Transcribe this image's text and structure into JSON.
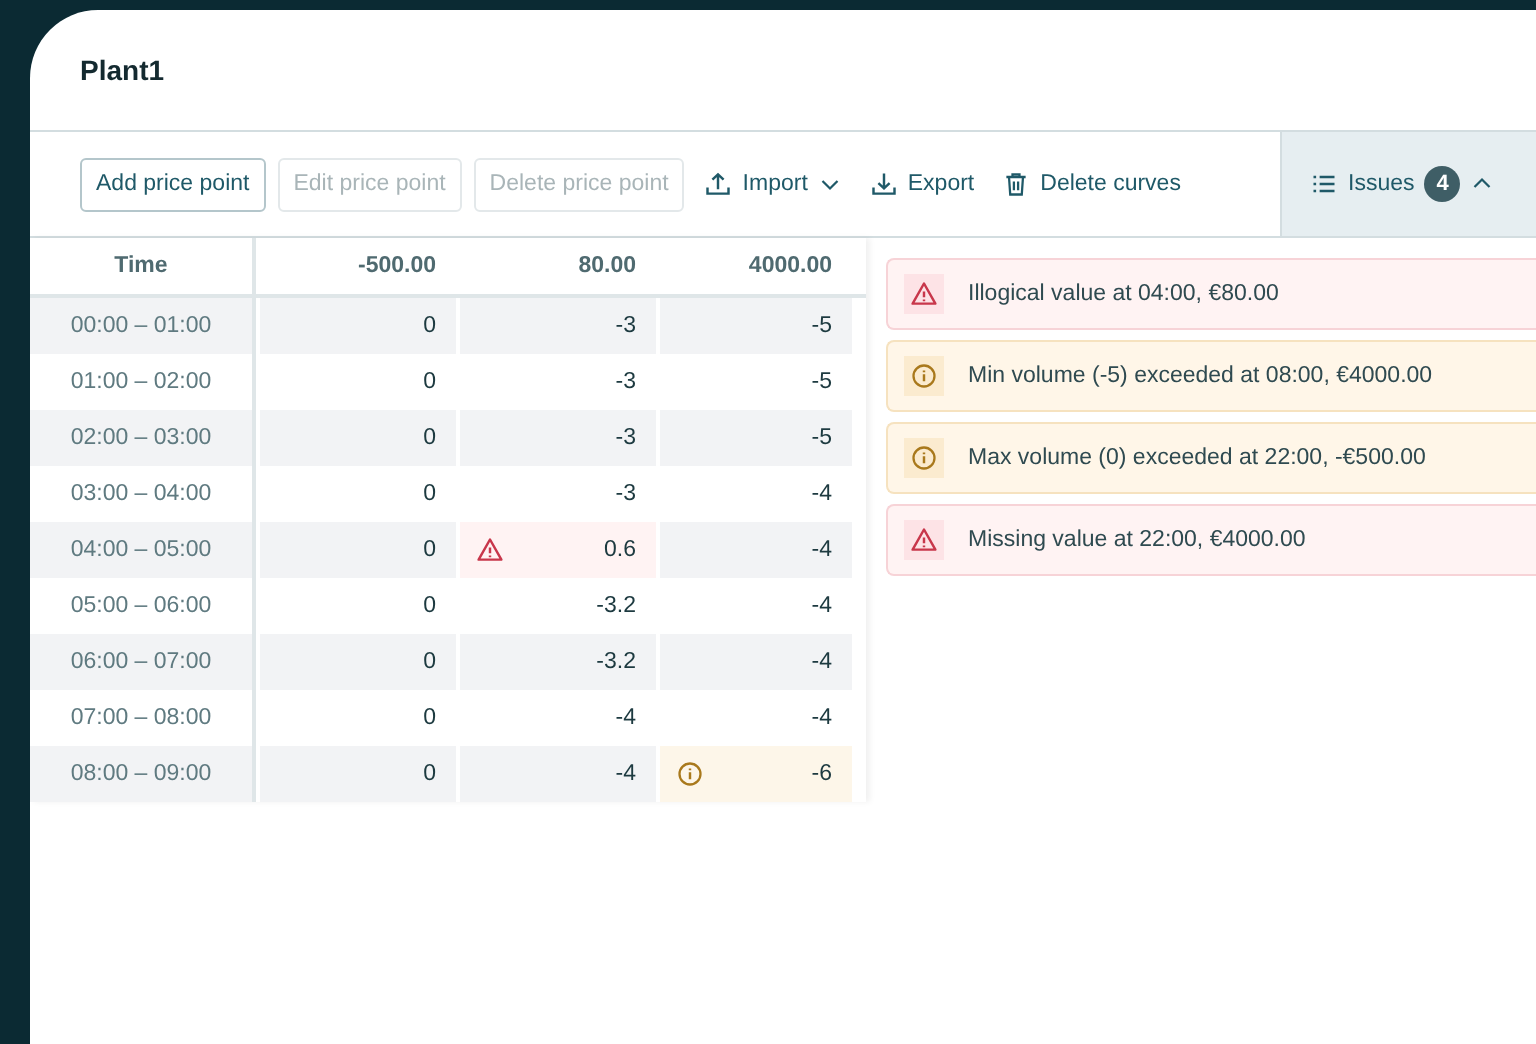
{
  "title": "Plant1",
  "buttons": [
    {
      "label": "Add price point",
      "disabled": false
    },
    {
      "label": "Edit price point",
      "disabled": true
    },
    {
      "label": "Delete price point",
      "disabled": true
    }
  ],
  "tools": [
    {
      "kind": "import",
      "label": "Import"
    },
    {
      "kind": "export",
      "label": "Export"
    },
    {
      "kind": "delete",
      "label": "Delete curves"
    }
  ],
  "issues_toggle": {
    "label": "Issues",
    "count": "4",
    "expanded": true
  },
  "table": {
    "columns": [
      "Time",
      "-500.00",
      "80.00",
      "4000.00"
    ],
    "rows": [
      {
        "cells": [
          {
            "value": "00:00 – 01:00",
            "error": false,
            "warning": false
          },
          {
            "value": "0",
            "error": false,
            "warning": false
          },
          {
            "value": "-3",
            "error": false,
            "warning": false
          },
          {
            "value": "-5",
            "error": false,
            "warning": false
          }
        ]
      },
      {
        "cells": [
          {
            "value": "01:00 – 02:00",
            "error": false,
            "warning": false
          },
          {
            "value": "0",
            "error": false,
            "warning": false
          },
          {
            "value": "-3",
            "error": false,
            "warning": false
          },
          {
            "value": "-5",
            "error": false,
            "warning": false
          }
        ]
      },
      {
        "cells": [
          {
            "value": "02:00 – 03:00",
            "error": false,
            "warning": false
          },
          {
            "value": "0",
            "error": false,
            "warning": false
          },
          {
            "value": "-3",
            "error": false,
            "warning": false
          },
          {
            "value": "-5",
            "error": false,
            "warning": false
          }
        ]
      },
      {
        "cells": [
          {
            "value": "03:00 – 04:00",
            "error": false,
            "warning": false
          },
          {
            "value": "0",
            "error": false,
            "warning": false
          },
          {
            "value": "-3",
            "error": false,
            "warning": false
          },
          {
            "value": "-4",
            "error": false,
            "warning": false
          }
        ]
      },
      {
        "cells": [
          {
            "value": "04:00 – 05:00",
            "error": false,
            "warning": false
          },
          {
            "value": "0",
            "error": false,
            "warning": false
          },
          {
            "value": "0.6",
            "error": true,
            "warning": false
          },
          {
            "value": "-4",
            "error": false,
            "warning": false
          }
        ]
      },
      {
        "cells": [
          {
            "value": "05:00 – 06:00",
            "error": false,
            "warning": false
          },
          {
            "value": "0",
            "error": false,
            "warning": false
          },
          {
            "value": "-3.2",
            "error": false,
            "warning": false
          },
          {
            "value": "-4",
            "error": false,
            "warning": false
          }
        ]
      },
      {
        "cells": [
          {
            "value": "06:00 – 07:00",
            "error": false,
            "warning": false
          },
          {
            "value": "0",
            "error": false,
            "warning": false
          },
          {
            "value": "-3.2",
            "error": false,
            "warning": false
          },
          {
            "value": "-4",
            "error": false,
            "warning": false
          }
        ]
      },
      {
        "cells": [
          {
            "value": "07:00 – 08:00",
            "error": false,
            "warning": false
          },
          {
            "value": "0",
            "error": false,
            "warning": false
          },
          {
            "value": "-4",
            "error": false,
            "warning": false
          },
          {
            "value": "-4",
            "error": false,
            "warning": false
          }
        ]
      },
      {
        "cells": [
          {
            "value": "08:00 – 09:00",
            "error": false,
            "warning": false
          },
          {
            "value": "0",
            "error": false,
            "warning": false
          },
          {
            "value": "-4",
            "error": false,
            "warning": false
          },
          {
            "value": "-6",
            "error": false,
            "warning": true
          }
        ]
      }
    ]
  },
  "issues": [
    {
      "kind": "error",
      "text": "Illogical value at 04:00, €80.00"
    },
    {
      "kind": "warning",
      "text": "Min volume (-5) exceeded at 08:00, €4000.00"
    },
    {
      "kind": "warning",
      "text": "Max volume (0) exceeded at 22:00, -€500.00"
    },
    {
      "kind": "error",
      "text": "Missing value at 22:00, €4000.00"
    }
  ]
}
